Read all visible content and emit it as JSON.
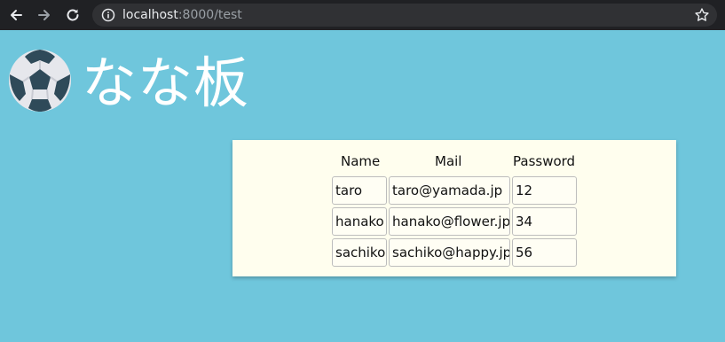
{
  "browser": {
    "url_host": "localhost",
    "url_path": ":8000/test"
  },
  "page": {
    "title": "なな板",
    "logo_icon": "soccer-ball-icon"
  },
  "table": {
    "headers": [
      "Name",
      "Mail",
      "Password"
    ],
    "rows": [
      [
        "taro",
        "taro@yamada.jp",
        "12"
      ],
      [
        "hanako",
        "hanako@flower.jp",
        "34"
      ],
      [
        "sachiko",
        "sachiko@happy.jp",
        "56"
      ]
    ]
  },
  "colors": {
    "background": "#6fc6dc",
    "card": "#fffeee",
    "browser_bar": "#202124"
  }
}
